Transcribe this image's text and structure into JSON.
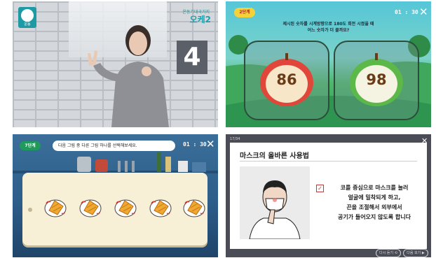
{
  "panel_video": {
    "logo_label": "운동",
    "brand_small": "온동기대국가지",
    "brand_big": "오케2",
    "count": "4"
  },
  "panel_apple": {
    "stage": "2단계",
    "timer": "01 : 30",
    "close_icon": "close-icon",
    "question_line1": "제시된 숫자를 시계방향으로 180도 회전 시켰을 때",
    "question_line2": "어느 숫자가 더 클까요?",
    "apples": [
      {
        "number": "86",
        "color": "#e0473a"
      },
      {
        "number": "98",
        "color": "#5cb848"
      }
    ]
  },
  "panel_kitchen": {
    "stage": "7단계",
    "timer": "01 : 30",
    "instruction": "다음 그림 중 다른 그림 하나를 선택해보세요.",
    "plates": [
      "plate-1",
      "plate-2",
      "plate-3",
      "plate-4",
      "plate-5"
    ]
  },
  "panel_lesson": {
    "page": "17/34",
    "title": "마스크의 올바른 사용법",
    "body_lines": [
      "코를 중심으로 마스크를 눌러",
      "얼굴에 밀착되게 하고,",
      "끈을 조절해서 외부에서",
      "공기가 들어오지 않도록 합니다"
    ],
    "replay_label": "다시 듣기 ⟲",
    "next_label": "다음 보기 ▶"
  },
  "colors": {
    "stage_badge_bg": "#f4d23a",
    "stage_badge_text": "#b12a1a",
    "kitchen_badge_bg": "#1f9a5a",
    "close_x": "#ffffff"
  }
}
